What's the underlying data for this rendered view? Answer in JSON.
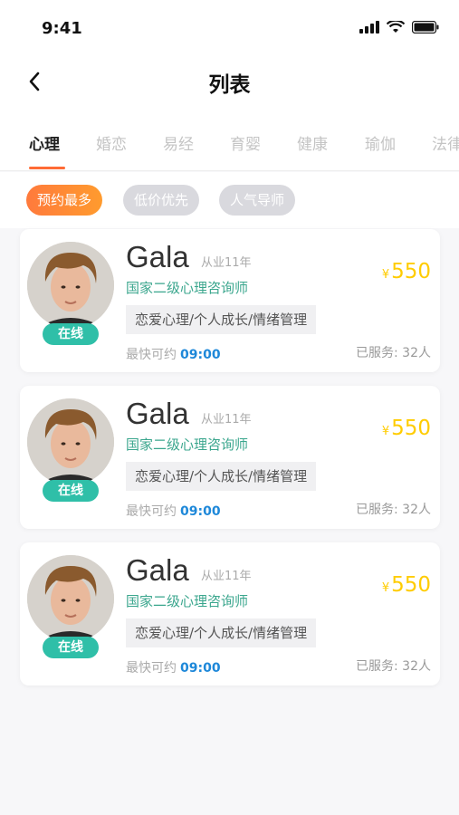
{
  "status": {
    "time": "9:41"
  },
  "nav": {
    "title": "列表"
  },
  "tabs": [
    "心理",
    "婚恋",
    "易经",
    "育婴",
    "健康",
    "瑜伽",
    "法律"
  ],
  "filters": [
    "预约最多",
    "低价优先",
    "人气导师"
  ],
  "cards": [
    {
      "name": "Gala",
      "experience": "从业11年",
      "certificate": "国家二级心理咨询师",
      "tags": "恋爱心理/个人成长/情绪管理",
      "earliest_label": "最快可约",
      "earliest_time": "09:00",
      "currency": "¥",
      "price": "550",
      "served": "已服务: 32人",
      "status": "在线"
    },
    {
      "name": "Gala",
      "experience": "从业11年",
      "certificate": "国家二级心理咨询师",
      "tags": "恋爱心理/个人成长/情绪管理",
      "earliest_label": "最快可约",
      "earliest_time": "09:00",
      "currency": "¥",
      "price": "550",
      "served": "已服务: 32人",
      "status": "在线"
    },
    {
      "name": "Gala",
      "experience": "从业11年",
      "certificate": "国家二级心理咨询师",
      "tags": "恋爱心理/个人成长/情绪管理",
      "earliest_label": "最快可约",
      "earliest_time": "09:00",
      "currency": "¥",
      "price": "550",
      "served": "已服务: 32人",
      "status": "在线"
    }
  ],
  "colors": {
    "accent": "#ff6b35",
    "online": "#2fbfa8",
    "price": "#ffcc00",
    "time": "#1e88d9",
    "certificate": "#3aa68d"
  }
}
